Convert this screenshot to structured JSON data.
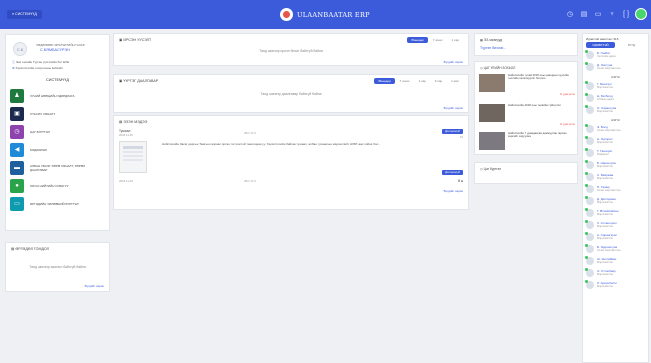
{
  "topbar": {
    "system_button": "≡ СИСТЕМҮҮД",
    "brand": "ULAANBAATAR ERP",
    "icons": [
      "clock-icon",
      "chart-icon",
      "chat-icon",
      "pin-icon",
      "bracket-icon",
      "avatar"
    ]
  },
  "profile": {
    "initials": "С.Б",
    "org": "ХӨДӨЛМӨР ЭРХЛЭЛТИЙН ГАЗАР",
    "name": "С.БЯМБАСҮРЭН",
    "link1": "Энэ онлайн Тургэн үүсгэлийн бит EXE",
    "link2": "Хэрэглэгчийн тохиргооны вэбсайт"
  },
  "systems": {
    "heading": "СИСТЕМҮҮД",
    "items": [
      {
        "label": "ХҮНИЙ НӨӨЦИЙН УДИРДЛАГА",
        "color": "#1f7a3d",
        "icon": "people-icon"
      },
      {
        "label": "СТАСИЧ ХЯНАЛТ",
        "color": "#1b2a4e",
        "icon": "monitor-icon"
      },
      {
        "label": "ЦАГ БҮРТГЭЛ",
        "color": "#8e44ad",
        "icon": "clock-icon"
      },
      {
        "label": "МЭДЭЭЛЭЛ",
        "color": "#1e8ad8",
        "icon": "speaker-icon"
      },
      {
        "label": "АЛБАН УБСЭГ ХӨРӨ ХЯНАЛТ, ТӨРӨЛ ДААЛГАВАР",
        "color": "#1f5f9e",
        "icon": "folder-icon"
      },
      {
        "label": "ОЛОН НИЙТИЙН СУВАГУУ",
        "color": "#2aa34a",
        "icon": "chat-icon"
      },
      {
        "label": "ИРГЭДИЙН ЧӨЛӨӨНИЙ БҮРТГЭЛ",
        "color": "#0e9bb0",
        "icon": "id-card-icon"
      }
    ]
  },
  "requests": {
    "title": "ӨРГӨДӨЛ ГОМДОЛ",
    "empty": "Танд шинээр ажилсл байхгүй байна",
    "more": "Бүгдийг харах"
  },
  "received_docs": {
    "title": "ИРСЭН УУСЭЛТ",
    "tabs": [
      "Өнөөдөр",
      "7 хоног",
      "1 сар"
    ],
    "empty": "Танд шинээр ирсэн бичиг байхгүй байна",
    "more": "Бүгдийг харах"
  },
  "tasks": {
    "title": "ҮҮРГЭГ ДААЛГАВАР",
    "tabs": [
      "Өнөөдөр",
      "7 хоног",
      "1 сар",
      "6 сар",
      "1 жил"
    ],
    "empty": "Танд шинээр даалгавар байхгүй байна",
    "more": "Бүгдийг харах"
  },
  "news": {
    "title": "ЭЗЭН МЭДЭЭ",
    "post1_author": "Тушаал",
    "post1_date": "2018.11.26",
    "post1_count": "253 ▪ 8 ⊙",
    "post1_badge": "Дэлгэрэнгүй",
    "post1_number": "15",
    "post2_text": "Нийслэлийн Засаг даргын Тамгын газраас ирсэн тогтоолтой танилцана уу. Хэрэглэгчийн байгаа тушаал, албан тушаалын мэдээллийг НХБГ-аас хийнэ бол...",
    "post2_badge": "Дэлгэрэнгүй",
    "post2_date": "2018.11.26",
    "post2_count": "253 ▪ 8 ⊙",
    "post2_react": "8 ●",
    "more": "Бүгдийг харах"
  },
  "calendar_notice": {
    "title": "ЭЗ-чаганууд",
    "text": "Түргэн бичлаг..."
  },
  "news_feed": {
    "title": "ЦАГ ҮЕИЙН ЗОХЬОЛ",
    "items": [
      {
        "text": "Нийслэлийн тухай 2018 оны цаашдын хуулийн төслийн хэлэлцүүлэг боллоо",
        "meta": "11 удаа үзсэн"
      },
      {
        "text": "Нийслэлийн 2018 оны төсвийн гүйцэтгэл",
        "meta": "11 удаа үзсэн"
      },
      {
        "text": "Нийслэлийн 7 удаадаагаа дамжуулан гарсан зарлийг харуулна",
        "meta": ""
      }
    ]
  },
  "calendar": {
    "title": "Цаг бүртгэл"
  },
  "people": {
    "title": "Идэвхтэй ажилтан: 315",
    "tabs": [
      "ИДЭВХТЭЙ",
      "БҮГД"
    ],
    "dept1": "НЭГЖ",
    "dept2": "НЭГЖ",
    "list": [
      {
        "name": "Б. Ганбат",
        "role": "Хэлтсийн дарга"
      },
      {
        "name": "Д. Энхтуяа",
        "role": "Ахлах мэргэжилтэн"
      },
      {
        "name": "Г. Мөнхзул",
        "role": "Мэргэжилтэн"
      },
      {
        "name": "Ц. Батболд",
        "role": "Албаны дарга"
      },
      {
        "name": "О. Сарантуяа",
        "role": "Мэргэжилтэн"
      },
      {
        "name": "Э. Болд",
        "role": "Ахлах мэргэжилтэн"
      },
      {
        "name": "Н. Одгэрэл",
        "role": "Мэргэжилтэн"
      },
      {
        "name": "Т. Ганзориг",
        "role": "Референт"
      },
      {
        "name": "Б. Нарантуяа",
        "role": "Мэргэжилтэн"
      },
      {
        "name": "С. Баярмаа",
        "role": "Мэргэжилтэн"
      },
      {
        "name": "П. Төмөр",
        "role": "Ахлах мэргэжилтэн"
      },
      {
        "name": "Д. Дэлгэрмаа",
        "role": "Мэргэжилтэн"
      },
      {
        "name": "Г. Өлзийсайхан",
        "role": "Мэргэжилтэн"
      },
      {
        "name": "Х. Алтангэрэл",
        "role": "Мэргэжилтэн"
      },
      {
        "name": "А. Сарангэрэл",
        "role": "Мэргэжилтэн"
      },
      {
        "name": "Б. Эрдэнэтуяа",
        "role": "Ахлах мэргэжилтэн"
      },
      {
        "name": "Ж. Энхтайван",
        "role": "Мэргэжилтэн"
      },
      {
        "name": "О. Отгонбаяр",
        "role": "Мэргэжилтэн"
      },
      {
        "name": "Л. Ариунбилэг",
        "role": "Мэргэжилтэн"
      }
    ]
  }
}
